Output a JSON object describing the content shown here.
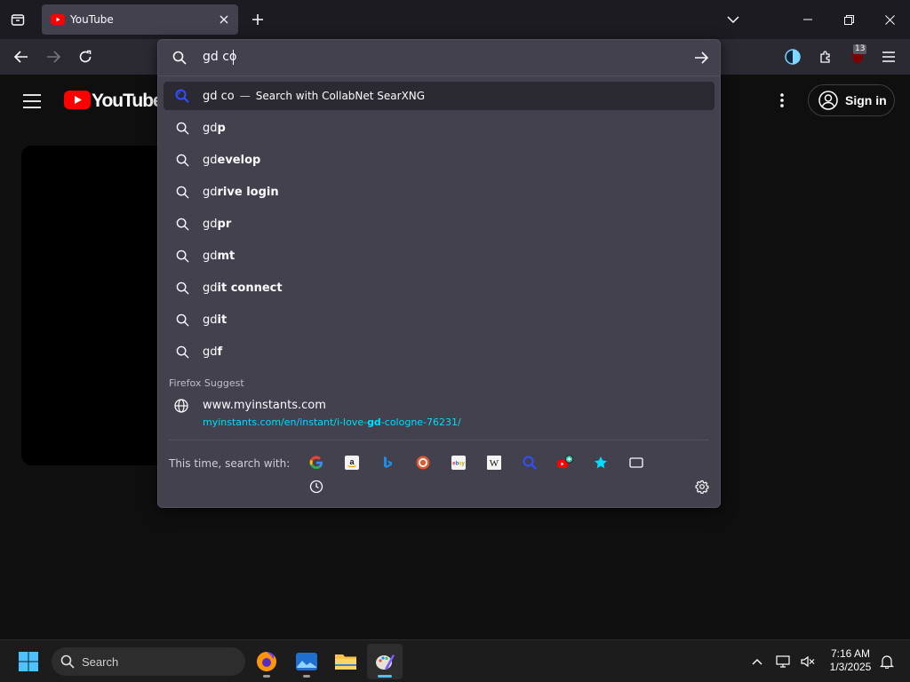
{
  "browser": {
    "tab": {
      "title": "YouTube"
    },
    "url_input": {
      "value": "gd co"
    },
    "notification_badge": "13"
  },
  "dropdown": {
    "heuristic": {
      "query": "gd co",
      "separator": "—",
      "action": "Search with CollabNet SearXNG"
    },
    "suggestions": [
      {
        "prefix": "gd",
        "completion": "p"
      },
      {
        "prefix": "gd",
        "completion": "evelop"
      },
      {
        "prefix": "gd",
        "completion": "rive login"
      },
      {
        "prefix": "gd",
        "completion": "pr"
      },
      {
        "prefix": "gd",
        "completion": "mt"
      },
      {
        "prefix": "gd",
        "completion": "it connect"
      },
      {
        "prefix": "gd",
        "completion": "it"
      },
      {
        "prefix": "gd",
        "completion": "f"
      }
    ],
    "firefox_suggest_label": "Firefox Suggest",
    "site": {
      "title": "www.myinstants.com",
      "url_prefix": "myinstants.com/en/instant/i-love-",
      "url_bold": "gd",
      "url_suffix": "-cologne-76231/"
    },
    "oneoff_label": "This time, search with:",
    "engines": [
      "google",
      "amazon",
      "bing",
      "duckduckgo",
      "ebay",
      "wikipedia",
      "searxng",
      "youtube-add",
      "bookmarks",
      "tabs",
      "history"
    ]
  },
  "youtube": {
    "logo_text": "YouTube",
    "sign_in": "Sign in"
  },
  "taskbar": {
    "search_label": "Search",
    "time": "7:16 AM",
    "date": "1/3/2025"
  },
  "colors": {
    "accent_blue": "#00ddff",
    "youtube_red": "#ff0000",
    "panel_bg": "#42414d"
  }
}
